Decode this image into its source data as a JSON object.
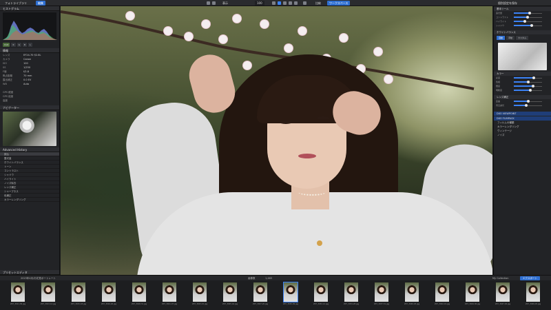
{
  "topbar": {
    "tab_library": "フォトライブラリ",
    "tab_edit": "編集",
    "zoom": "100",
    "open_folder": "表示",
    "preset": "比較",
    "right_btn": "個別設定を保存",
    "right_btn2": "ワークスペース"
  },
  "left": {
    "histogram_title": "ヒストグラム",
    "hist_chips": [
      "RGB",
      "R",
      "G",
      "B",
      "L"
    ],
    "info_title": "情報",
    "info_rows": [
      {
        "k": "レンズ",
        "v": "EF24-70 f/2.8L"
      },
      {
        "k": "カメラ",
        "v": "Canon"
      },
      {
        "k": "ISO",
        "v": "100"
      },
      {
        "k": "SS",
        "v": "1/250"
      },
      {
        "k": "F値",
        "v": "f/2.8"
      },
      {
        "k": "焦点距離",
        "v": "70 mm"
      },
      {
        "k": "露出補正",
        "v": "0.0 EV"
      },
      {
        "k": "WB",
        "v": "Auto"
      }
    ],
    "gps_rows": [
      {
        "k": "GPS 緯度",
        "v": ""
      },
      {
        "k": "GPS 経度",
        "v": ""
      },
      {
        "k": "高度",
        "v": ""
      }
    ],
    "navigator_title": "ナビゲーター",
    "history_title": "Advanced History",
    "history_items": [
      "読込",
      "露光量",
      "ホワイトバランス",
      "トーン",
      "コントラスト",
      "シャドウ",
      "ハイライト",
      "ノイズ除去",
      "レンズ補正",
      "シャープネス",
      "色補正",
      "カラーレンダリング"
    ],
    "presets_title": "プリセットエディタ"
  },
  "right": {
    "basic_title": "基本ツール",
    "sliders_a": [
      {
        "label": "露光量",
        "level": 0.55
      },
      {
        "label": "コントラスト",
        "level": 0.48
      },
      {
        "label": "ハイライト",
        "level": 0.38
      },
      {
        "label": "シャドウ",
        "level": 0.62
      }
    ],
    "wb_title": "ホワイトバランス",
    "toggle": [
      "自動",
      "手動",
      "カスタム"
    ],
    "color_title": "カラー",
    "sliders_b": [
      {
        "label": "彩度",
        "level": 0.7
      },
      {
        "label": "色相",
        "level": 0.5
      },
      {
        "label": "輝度",
        "level": 0.66
      },
      {
        "label": "明瞭度",
        "level": 0.58
      }
    ],
    "lens_title": "レンズ補正",
    "sliders_c": [
      {
        "label": "歪曲",
        "level": 0.5
      },
      {
        "label": "周辺減光",
        "level": 0.44
      }
    ],
    "viewpoint_title": "DXO VIEWPOINT",
    "filmpack_title": "DXO FILMPACK",
    "filmpack_rows": [
      "フィルムの種類",
      "カラーレンダリング",
      "ヴィンテージ",
      "ノイズ"
    ]
  },
  "filmstrip": {
    "count_label": "画像数",
    "count": "1,463",
    "path": "2023年4月/お花見ポートレート",
    "export_label": "エクスポート",
    "collection": "My Collection",
    "items": [
      "Z07_3011-36.jpg",
      "Z07_3013-14.jpg",
      "Z07_3015-18.jpg",
      "Z07_3016-26.jpg",
      "Z07_3018-31.jpg",
      "Z07_3021-07.jpg",
      "Z07_3023-15.jpg",
      "Z07_3025-44.jpg",
      "Z07_3027-20.jpg",
      "Z07_3030-09.jpg",
      "Z07_3032-12.jpg",
      "Z07_3034-28.jpg",
      "Z07_3037-51.jpg",
      "Z07_3040-03.jpg",
      "Z07_3042-19.jpg",
      "Z07_3044-36.jpg",
      "Z07_3047-02.jpg",
      "Z07_3049-45.jpg"
    ]
  }
}
